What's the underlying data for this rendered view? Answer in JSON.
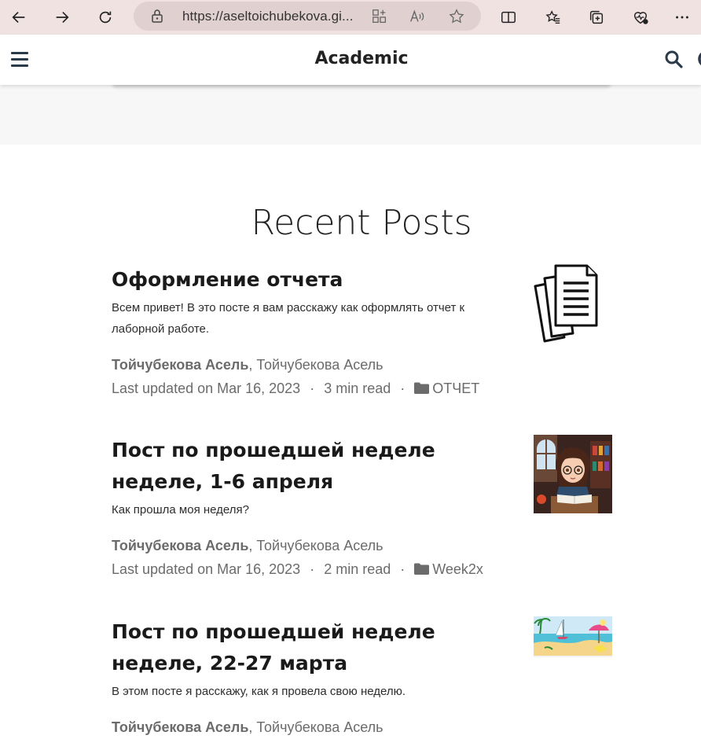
{
  "browser": {
    "url": "https://aseltoichubekova.gi..."
  },
  "site": {
    "title": "Academic"
  },
  "section": {
    "title": "Recent Posts"
  },
  "posts": [
    {
      "title": "Оформление отчета",
      "summary": "Всем привет! В это посте я вам расскажу как оформлять отчет к лаборной работе.",
      "author_bold": "Тойчубекова Асель",
      "author_sep": ", ",
      "author_rest": "Тойчубекова Асель",
      "updated": "Last updated on Mar 16, 2023",
      "read_time": "3 min read",
      "category": "ОТЧЕТ",
      "thumb": "documents-icon"
    },
    {
      "title": "Пост по прошедшей неделе неделе, 1-6 апреля",
      "summary": "Как прошла моя неделя?",
      "author_bold": "Тойчубекова Асель",
      "author_sep": ", ",
      "author_rest": "Тойчубекова Асель",
      "updated": "Last updated on Mar 16, 2023",
      "read_time": "2 min read",
      "category": "Week2x",
      "thumb": "girl-studying-illustration"
    },
    {
      "title": "Пост по прошедшей неделе неделе, 22-27 марта",
      "summary": "В этом посте я расскажу, как я провела свою неделю.",
      "author_bold": "Тойчубекова Асель",
      "author_sep": ", ",
      "author_rest": "Тойчубекова Асель",
      "thumb": "beach-illustration"
    }
  ],
  "meta_separator": "·",
  "colors": {
    "browser_bar": "#f1e2e2",
    "nav_icon": "#2b3a4a",
    "muted_text": "#6b6b6b"
  }
}
